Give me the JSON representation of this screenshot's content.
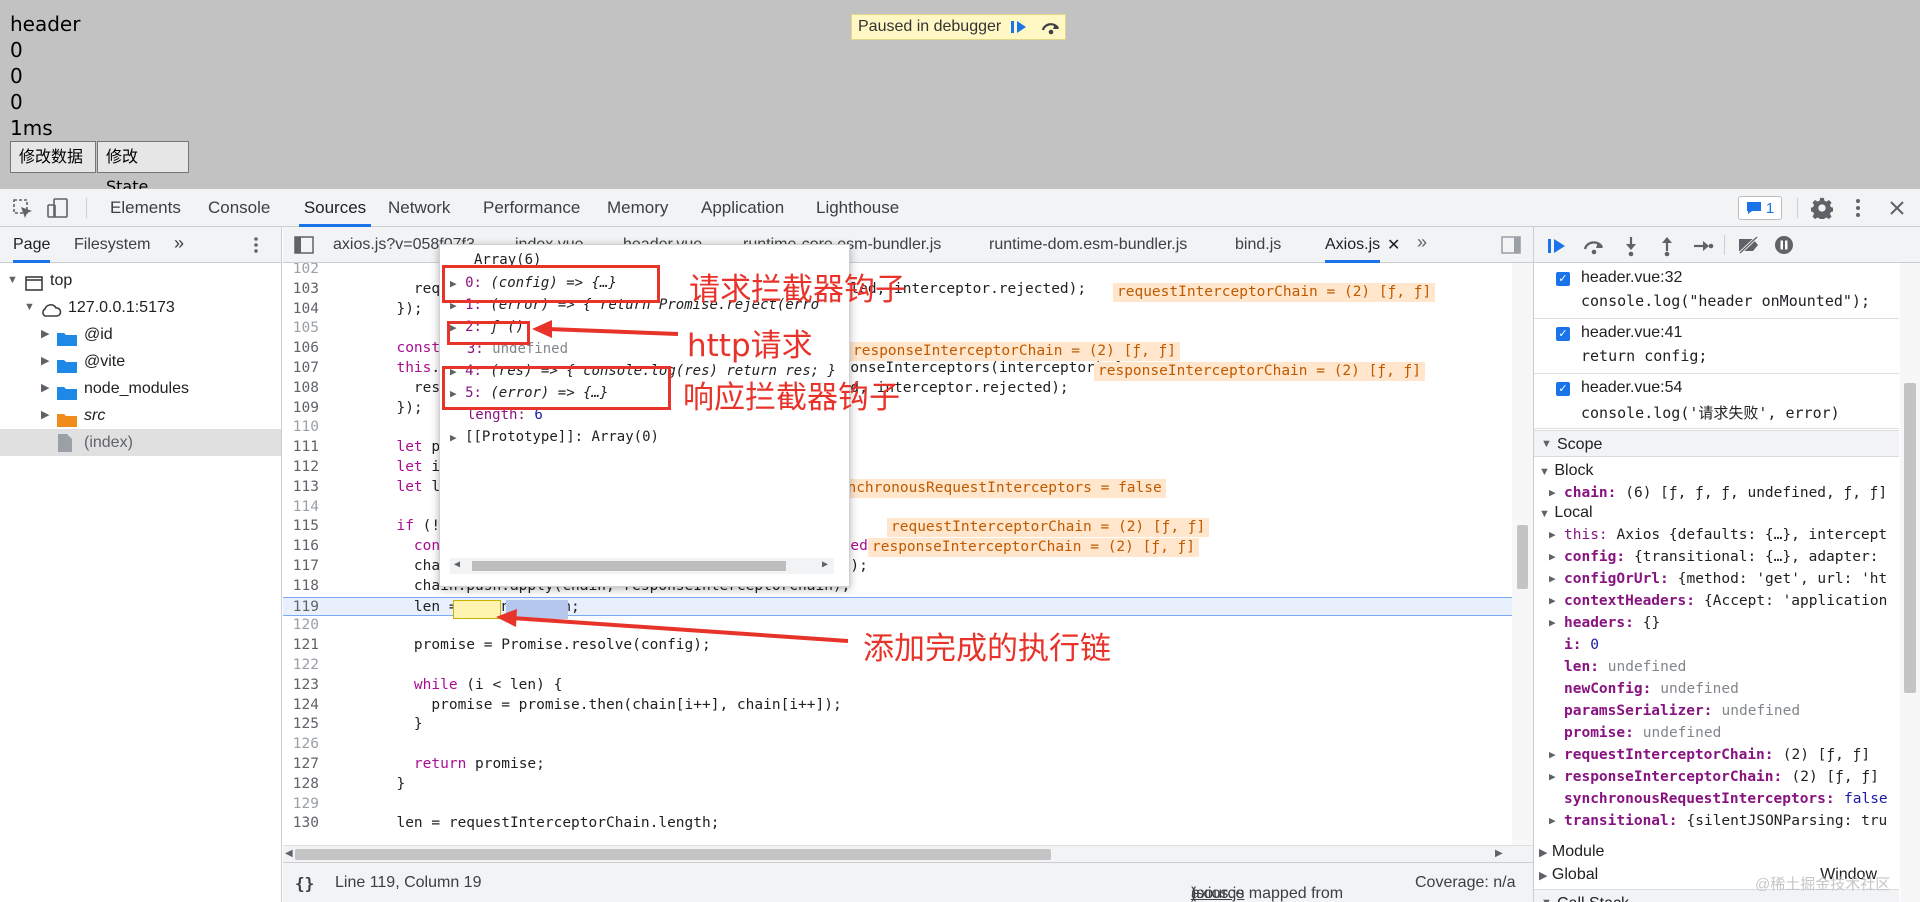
{
  "preview": {
    "lines": [
      "header",
      "0",
      "0",
      "0",
      "1ms"
    ],
    "btn_modify_data": "修改数据",
    "btn_modify_state": "修改State",
    "debugger_pill": "Paused in debugger"
  },
  "devtools_tabs": [
    "Elements",
    "Console",
    "Sources",
    "Network",
    "Performance",
    "Memory",
    "Application",
    "Lighthouse"
  ],
  "issues_badge": "1",
  "navigator": {
    "tabs": [
      "Page",
      "Filesystem"
    ],
    "tree": [
      "top",
      "127.0.0.1:5173",
      "@id",
      "@vite",
      "node_modules",
      "src",
      "(index)"
    ]
  },
  "file_tabs": [
    "axios.js?v=058f07f3",
    "index.vue",
    "header.vue",
    "runtime-core.esm-bundler.js",
    "runtime-dom.esm-bundler.js",
    "bind.js",
    "Axios.js"
  ],
  "code_lines": [
    {
      "n": "102",
      "text": ""
    },
    {
      "n": "103",
      "text": "    requestInterceptorChain.unshift(interceptor.fulfilled, interceptor.rejected);"
    },
    {
      "n": "104",
      "text": "  });"
    },
    {
      "n": "105",
      "text": ""
    },
    {
      "n": "106",
      "text": "  const responseInterceptorChain = [];"
    },
    {
      "n": "107",
      "text": "  this.interceptors.response.forEach(function pushResponseInterceptors(interceptor) {"
    },
    {
      "n": "108",
      "text": "    responseInterceptorChain.push(interceptor.fulfilled, interceptor.rejected);"
    },
    {
      "n": "109",
      "text": "  });"
    },
    {
      "n": "110",
      "text": ""
    },
    {
      "n": "111",
      "text": "  let promise;"
    },
    {
      "n": "112",
      "text": "  let i = 0;"
    },
    {
      "n": "113",
      "text": "  let len;"
    },
    {
      "n": "114",
      "text": ""
    },
    {
      "n": "115",
      "text": "  if (!synchronousRequestInterceptors) {"
    },
    {
      "n": "116",
      "text": "    const chain = [dispatchRequest.bind(this), undefined];"
    },
    {
      "n": "117",
      "text": "    chain.unshift.apply(chain, requestInterceptorChain);"
    },
    {
      "n": "118",
      "text": "    chain.push.apply(chain, responseInterceptorChain);"
    },
    {
      "n": "119",
      "text": "    len = chain.length;"
    },
    {
      "n": "120",
      "text": ""
    },
    {
      "n": "121",
      "text": "    promise = Promise.resolve(config);"
    },
    {
      "n": "122",
      "text": ""
    },
    {
      "n": "123",
      "text": "    while (i < len) {"
    },
    {
      "n": "124",
      "text": "      promise = promise.then(chain[i++], chain[i++]);"
    },
    {
      "n": "125",
      "text": "    }"
    },
    {
      "n": "126",
      "text": ""
    },
    {
      "n": "127",
      "text": "    return promise;"
    },
    {
      "n": "128",
      "text": "  }"
    },
    {
      "n": "129",
      "text": ""
    },
    {
      "n": "130",
      "text": "  len = requestInterceptorChain.length;"
    }
  ],
  "inline_values": {
    "l103": "requestInterceptorChain = (2) [ƒ, ƒ]",
    "l106": "responseInterceptorChain = (2) [ƒ, ƒ]",
    "l108": "responseInterceptorChain = (2) [ƒ, ƒ]",
    "l115": "synchronousRequestInterceptors = false",
    "l117": "requestInterceptorChain = (2) [ƒ, ƒ]",
    "l118": "responseInterceptorChain = (2) [ƒ, ƒ]"
  },
  "popover": {
    "title": "Array(6)",
    "items": [
      {
        "k": "0:",
        "v": "(config) => {…}"
      },
      {
        "k": "1:",
        "v": "(error) => { return Promise.reject(erro"
      },
      {
        "k": "2:",
        "v": "ƒ ()"
      },
      {
        "k": "3:",
        "v": "undefined"
      },
      {
        "k": "4:",
        "v": "(res) => { console.log(res) return res; }"
      },
      {
        "k": "5:",
        "v": "(error) => {…}"
      },
      {
        "k": "length:",
        "v": "6"
      },
      {
        "k": "[[Prototype]]:",
        "v": "Array(0)"
      }
    ]
  },
  "annotations": {
    "req_hook": "请求拦截器钩子",
    "http_req": "http请求",
    "resp_hook": "响应拦截器钩子",
    "chain_done": "添加完成的执行链"
  },
  "status_bar": {
    "position": "Line 119, Column 19",
    "source_mapped": "(source mapped from ",
    "source_file": "axios.js",
    "source_tail": ")",
    "coverage": "Coverage: n/a"
  },
  "breakpoints": [
    {
      "file": "header.vue:32",
      "code": "console.log(\"header onMounted\");"
    },
    {
      "file": "header.vue:41",
      "code": "return config;"
    },
    {
      "file": "header.vue:54",
      "code": "console.log('请求失败', error)"
    }
  ],
  "scope": {
    "title": "Scope",
    "block": "Block",
    "local": "Local",
    "module": "Module",
    "global": "Global",
    "global_val": "Window",
    "callstack": "Call Stack",
    "vars": [
      {
        "name": "chain",
        "val": "(6) [ƒ, ƒ, ƒ, undefined, ƒ, ƒ]",
        "expand": true
      },
      {
        "name": "this",
        "val": "Axios {defaults: {…}, intercept",
        "expand": true
      },
      {
        "name": "config",
        "val": "{transitional: {…}, adapter:",
        "expand": true
      },
      {
        "name": "configOrUrl",
        "val": "{method: 'get', url: 'ht",
        "expand": true
      },
      {
        "name": "contextHeaders",
        "val": "{Accept: 'application",
        "expand": true
      },
      {
        "name": "headers",
        "val": "{}",
        "expand": true
      },
      {
        "name": "i",
        "val": "0",
        "expand": false
      },
      {
        "name": "len",
        "val": "undefined",
        "expand": false
      },
      {
        "name": "newConfig",
        "val": "undefined",
        "expand": false
      },
      {
        "name": "paramsSerializer",
        "val": "undefined",
        "expand": false
      },
      {
        "name": "promise",
        "val": "undefined",
        "expand": false
      },
      {
        "name": "requestInterceptorChain",
        "val": "(2) [ƒ, ƒ]",
        "expand": true
      },
      {
        "name": "responseInterceptorChain",
        "val": "(2) [ƒ, ƒ]",
        "expand": true
      },
      {
        "name": "synchronousRequestInterceptors",
        "val": "false",
        "expand": false
      },
      {
        "name": "transitional",
        "val": "{silentJSONParsing: tru",
        "expand": true
      }
    ]
  },
  "watermark": "@稀土掘金技术社区",
  "colors": {
    "accent": "#1a73e8",
    "annotation": "#e8332a",
    "inline_value_bg": "#ffe6cc"
  }
}
